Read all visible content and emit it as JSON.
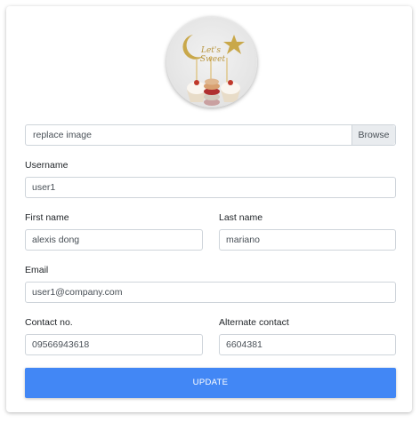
{
  "profile": {
    "avatar_alt": "",
    "file_input": {
      "label": "replace image",
      "browse_label": "Browse"
    }
  },
  "form": {
    "username": {
      "label": "Username",
      "value": "user1"
    },
    "first_name": {
      "label": "First name",
      "value": "alexis dong"
    },
    "last_name": {
      "label": "Last name",
      "value": "mariano"
    },
    "email": {
      "label": "Email",
      "value": "user1@company.com"
    },
    "contact": {
      "label": "Contact no.",
      "value": "09566943618"
    },
    "alternate_contact": {
      "label": "Alternate contact",
      "value": "6604381"
    }
  },
  "actions": {
    "update_label": "UPDATE"
  },
  "colors": {
    "primary": "#4287f5",
    "input_border": "#ced4da",
    "browse_bg": "#e9ecef"
  }
}
